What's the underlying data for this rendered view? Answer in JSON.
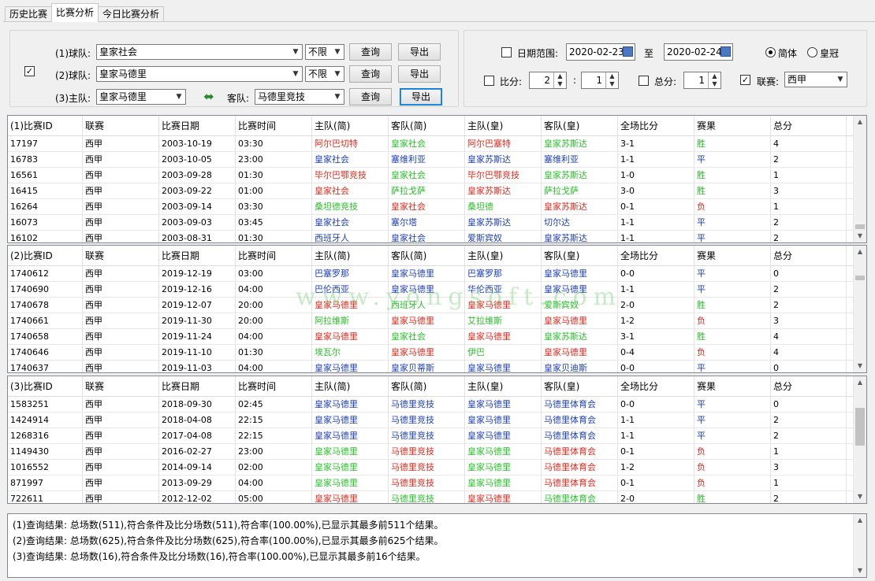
{
  "tabs": [
    "历史比赛",
    "比赛分析",
    "今日比赛分析"
  ],
  "query": {
    "team1_label": "(1)球队:",
    "team1_value": "皇家社会",
    "team1_limit": "不限",
    "team2_label": "(2)球队:",
    "team2_value": "皇家马德里",
    "team2_limit": "不限",
    "team3_label": "(3)主队:",
    "team3_value": "皇家马德里",
    "away_label": "客队:",
    "away_value": "马德里竞技",
    "query_btn": "查询",
    "export_btn": "导出"
  },
  "filters": {
    "date_range_label": "日期范围:",
    "date_from": "2020-02-23",
    "to_label": "至",
    "date_to": "2020-02-24",
    "simplified": "简体",
    "traditional": "皇冠",
    "score_label": "比分:",
    "score_home": "2",
    "score_sep": ":",
    "score_away": "1",
    "total_label": "总分:",
    "total_value": "1",
    "league_label": "联赛:",
    "league_value": "西甲"
  },
  "columns_1": [
    "(1)比赛ID",
    "联赛",
    "比赛日期",
    "比赛时间",
    "主队(简)",
    "客队(简)",
    "主队(皇)",
    "客队(皇)",
    "全场比分",
    "赛果",
    "总分"
  ],
  "columns_2": [
    "(2)比赛ID",
    "联赛",
    "比赛日期",
    "比赛时间",
    "主队(简)",
    "客队(简)",
    "主队(皇)",
    "客队(皇)",
    "全场比分",
    "赛果",
    "总分"
  ],
  "columns_3": [
    "(3)比赛ID",
    "联赛",
    "比赛日期",
    "比赛时间",
    "主队(简)",
    "客队(简)",
    "主队(皇)",
    "客队(皇)",
    "全场比分",
    "赛果",
    "总分"
  ],
  "grid1": [
    [
      "17197",
      "西甲",
      "2003-10-19",
      "03:30",
      "阿尔巴切特",
      "皇家社会",
      "阿尔巴塞特",
      "皇家苏斯达",
      "3-1",
      "胜",
      "4"
    ],
    [
      "16783",
      "西甲",
      "2003-10-05",
      "23:00",
      "皇家社会",
      "塞维利亚",
      "皇家苏斯达",
      "塞维利亚",
      "1-1",
      "平",
      "2"
    ],
    [
      "16561",
      "西甲",
      "2003-09-28",
      "01:30",
      "毕尔巴鄂竞技",
      "皇家社会",
      "毕尔巴鄂竞技",
      "皇家苏斯达",
      "1-0",
      "胜",
      "1"
    ],
    [
      "16415",
      "西甲",
      "2003-09-22",
      "01:00",
      "皇家社会",
      "萨拉戈萨",
      "皇家苏斯达",
      "萨拉戈萨",
      "3-0",
      "胜",
      "3"
    ],
    [
      "16264",
      "西甲",
      "2003-09-14",
      "03:30",
      "桑坦德竞技",
      "皇家社会",
      "桑坦德",
      "皇家苏斯达",
      "0-1",
      "负",
      "1"
    ],
    [
      "16073",
      "西甲",
      "2003-09-03",
      "03:45",
      "皇家社会",
      "塞尔塔",
      "皇家苏斯达",
      "切尔达",
      "1-1",
      "平",
      "2"
    ],
    [
      "16102",
      "西甲",
      "2003-08-31",
      "01:30",
      "西班牙人",
      "皇家社会",
      "爱斯宾奴",
      "皇家苏斯达",
      "1-1",
      "平",
      "2"
    ]
  ],
  "grid2": [
    [
      "1740612",
      "西甲",
      "2019-12-19",
      "03:00",
      "巴塞罗那",
      "皇家马德里",
      "巴塞罗那",
      "皇家马德里",
      "0-0",
      "平",
      "0"
    ],
    [
      "1740690",
      "西甲",
      "2019-12-16",
      "04:00",
      "巴伦西亚",
      "皇家马德里",
      "华伦西亚",
      "皇家马德里",
      "1-1",
      "平",
      "2"
    ],
    [
      "1740678",
      "西甲",
      "2019-12-07",
      "20:00",
      "皇家马德里",
      "西班牙人",
      "皇家马德里",
      "爱斯宾奴",
      "2-0",
      "胜",
      "2"
    ],
    [
      "1740661",
      "西甲",
      "2019-11-30",
      "20:00",
      "阿拉维斯",
      "皇家马德里",
      "艾拉维斯",
      "皇家马德里",
      "1-2",
      "负",
      "3"
    ],
    [
      "1740658",
      "西甲",
      "2019-11-24",
      "04:00",
      "皇家马德里",
      "皇家社会",
      "皇家马德里",
      "皇家苏斯达",
      "3-1",
      "胜",
      "4"
    ],
    [
      "1740646",
      "西甲",
      "2019-11-10",
      "01:30",
      "埃瓦尔",
      "皇家马德里",
      "伊巴",
      "皇家马德里",
      "0-4",
      "负",
      "4"
    ],
    [
      "1740637",
      "西甲",
      "2019-11-03",
      "04:00",
      "皇家马德里",
      "皇家贝蒂斯",
      "皇家马德里",
      "皇家贝迪斯",
      "0-0",
      "平",
      "0"
    ]
  ],
  "grid3": [
    [
      "1583251",
      "西甲",
      "2018-09-30",
      "02:45",
      "皇家马德里",
      "马德里竞技",
      "皇家马德里",
      "马德里体育会",
      "0-0",
      "平",
      "0"
    ],
    [
      "1424914",
      "西甲",
      "2018-04-08",
      "22:15",
      "皇家马德里",
      "马德里竞技",
      "皇家马德里",
      "马德里体育会",
      "1-1",
      "平",
      "2"
    ],
    [
      "1268316",
      "西甲",
      "2017-04-08",
      "22:15",
      "皇家马德里",
      "马德里竞技",
      "皇家马德里",
      "马德里体育会",
      "1-1",
      "平",
      "2"
    ],
    [
      "1149430",
      "西甲",
      "2016-02-27",
      "23:00",
      "皇家马德里",
      "马德里竞技",
      "皇家马德里",
      "马德里体育会",
      "0-1",
      "负",
      "1"
    ],
    [
      "1016552",
      "西甲",
      "2014-09-14",
      "02:00",
      "皇家马德里",
      "马德里竞技",
      "皇家马德里",
      "马德里体育会",
      "1-2",
      "负",
      "3"
    ],
    [
      "871997",
      "西甲",
      "2013-09-29",
      "04:00",
      "皇家马德里",
      "马德里竞技",
      "皇家马德里",
      "马德里体育会",
      "0-1",
      "负",
      "1"
    ],
    [
      "722611",
      "西甲",
      "2012-12-02",
      "05:00",
      "皇家马德里",
      "马德里竞技",
      "皇家马德里",
      "马德里体育会",
      "2-0",
      "胜",
      "2"
    ]
  ],
  "colors": {
    "blue": "#1c3fb8",
    "red": "#e0281c",
    "green": "#28c028"
  },
  "grid1_colors": [
    [
      "r",
      "g",
      "r",
      "g"
    ],
    [
      "b",
      "b",
      "b",
      "b"
    ],
    [
      "r",
      "g",
      "r",
      "g"
    ],
    [
      "r",
      "g",
      "r",
      "g"
    ],
    [
      "g",
      "r",
      "g",
      "r"
    ],
    [
      "b",
      "b",
      "b",
      "b"
    ],
    [
      "b",
      "b",
      "b",
      "b"
    ]
  ],
  "grid2_colors": [
    [
      "b",
      "b",
      "b",
      "b"
    ],
    [
      "b",
      "b",
      "b",
      "b"
    ],
    [
      "r",
      "g",
      "r",
      "g"
    ],
    [
      "g",
      "r",
      "g",
      "r"
    ],
    [
      "r",
      "g",
      "r",
      "g"
    ],
    [
      "g",
      "r",
      "g",
      "r"
    ],
    [
      "b",
      "b",
      "b",
      "b"
    ]
  ],
  "grid3_colors": [
    [
      "b",
      "b",
      "b",
      "b"
    ],
    [
      "b",
      "b",
      "b",
      "b"
    ],
    [
      "b",
      "b",
      "b",
      "b"
    ],
    [
      "g",
      "r",
      "g",
      "r"
    ],
    [
      "g",
      "r",
      "g",
      "r"
    ],
    [
      "g",
      "r",
      "g",
      "r"
    ],
    [
      "r",
      "g",
      "r",
      "g"
    ]
  ],
  "watermark": "www.yongsoft.com",
  "results": [
    "(1)查询结果: 总场数(511),符合条件及比分场数(511),符合率(100.00%),已显示其最多前511个结果。",
    "(2)查询结果: 总场数(625),符合条件及比分场数(625),符合率(100.00%),已显示其最多前625个结果。",
    "(3)查询结果: 总场数(16),符合条件及比分场数(16),符合率(100.00%),已显示其最多前16个结果。"
  ]
}
